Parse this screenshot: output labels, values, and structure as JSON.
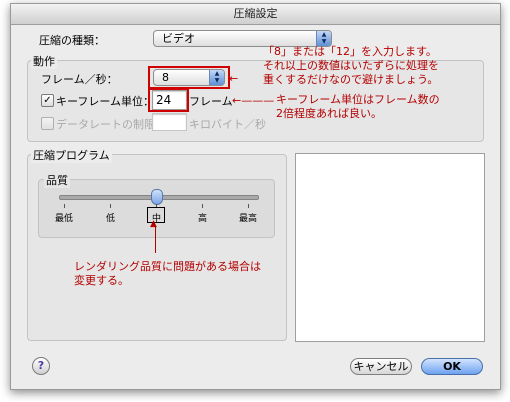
{
  "window": {
    "title": "圧縮設定"
  },
  "compression_type": {
    "label": "圧縮の種類：",
    "value": "ビデオ"
  },
  "motion": {
    "title": "動作",
    "frame_rate_label": "フレーム／秒：",
    "frame_rate_value": "8",
    "keyframe_checked": true,
    "keyframe_check_mark": "✓",
    "keyframe_label": "キーフレーム単位：",
    "keyframe_value": "24",
    "keyframe_unit": "フレーム",
    "data_rate_label": "データレートの制限：",
    "data_rate_value": "",
    "data_rate_unit": "キロバイト／秒"
  },
  "compressor": {
    "title": "圧縮プログラム",
    "quality": {
      "label": "品質",
      "levels": [
        "最低",
        "低",
        "中",
        "高",
        "最高"
      ],
      "selected": "中",
      "selected_level_fraction": 0.5
    }
  },
  "annotations": {
    "frame_rate": [
      "「8」または「12」を入力します。",
      "それ以上の数値はいたずらに処理を",
      "重くするだけなので避けましょう。"
    ],
    "keyframe": [
      "キーフレーム単位はフレーム数の",
      "2倍程度あれば良い。"
    ],
    "quality": [
      "レンダリング品質に問題がある場合は",
      "変更する。"
    ]
  },
  "annotation_color": "#b40000",
  "help_icon": "help-icon",
  "buttons": {
    "cancel": "キャンセル",
    "ok": "OK"
  }
}
